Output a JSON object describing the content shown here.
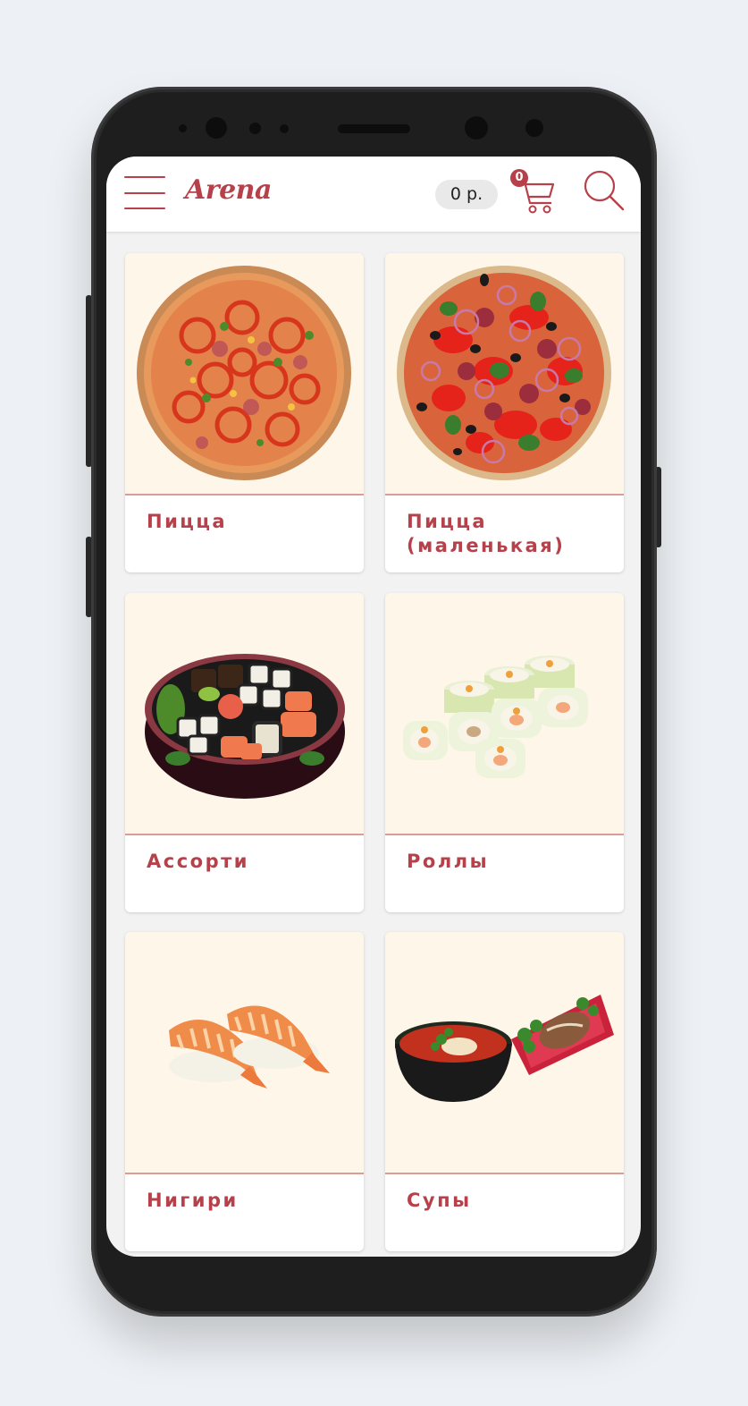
{
  "header": {
    "brand": "Arena",
    "price": "0 р.",
    "cart_count": "0"
  },
  "categories": [
    {
      "label": "Пицца"
    },
    {
      "label": "Пицца (маленькая)"
    },
    {
      "label": "Ассорти"
    },
    {
      "label": "Роллы"
    },
    {
      "label": "Нигири"
    },
    {
      "label": "Супы"
    }
  ],
  "colors": {
    "accent": "#b6414a",
    "card_image_bg": "#fdf6e9",
    "screen_bg": "#f2f2f2"
  }
}
